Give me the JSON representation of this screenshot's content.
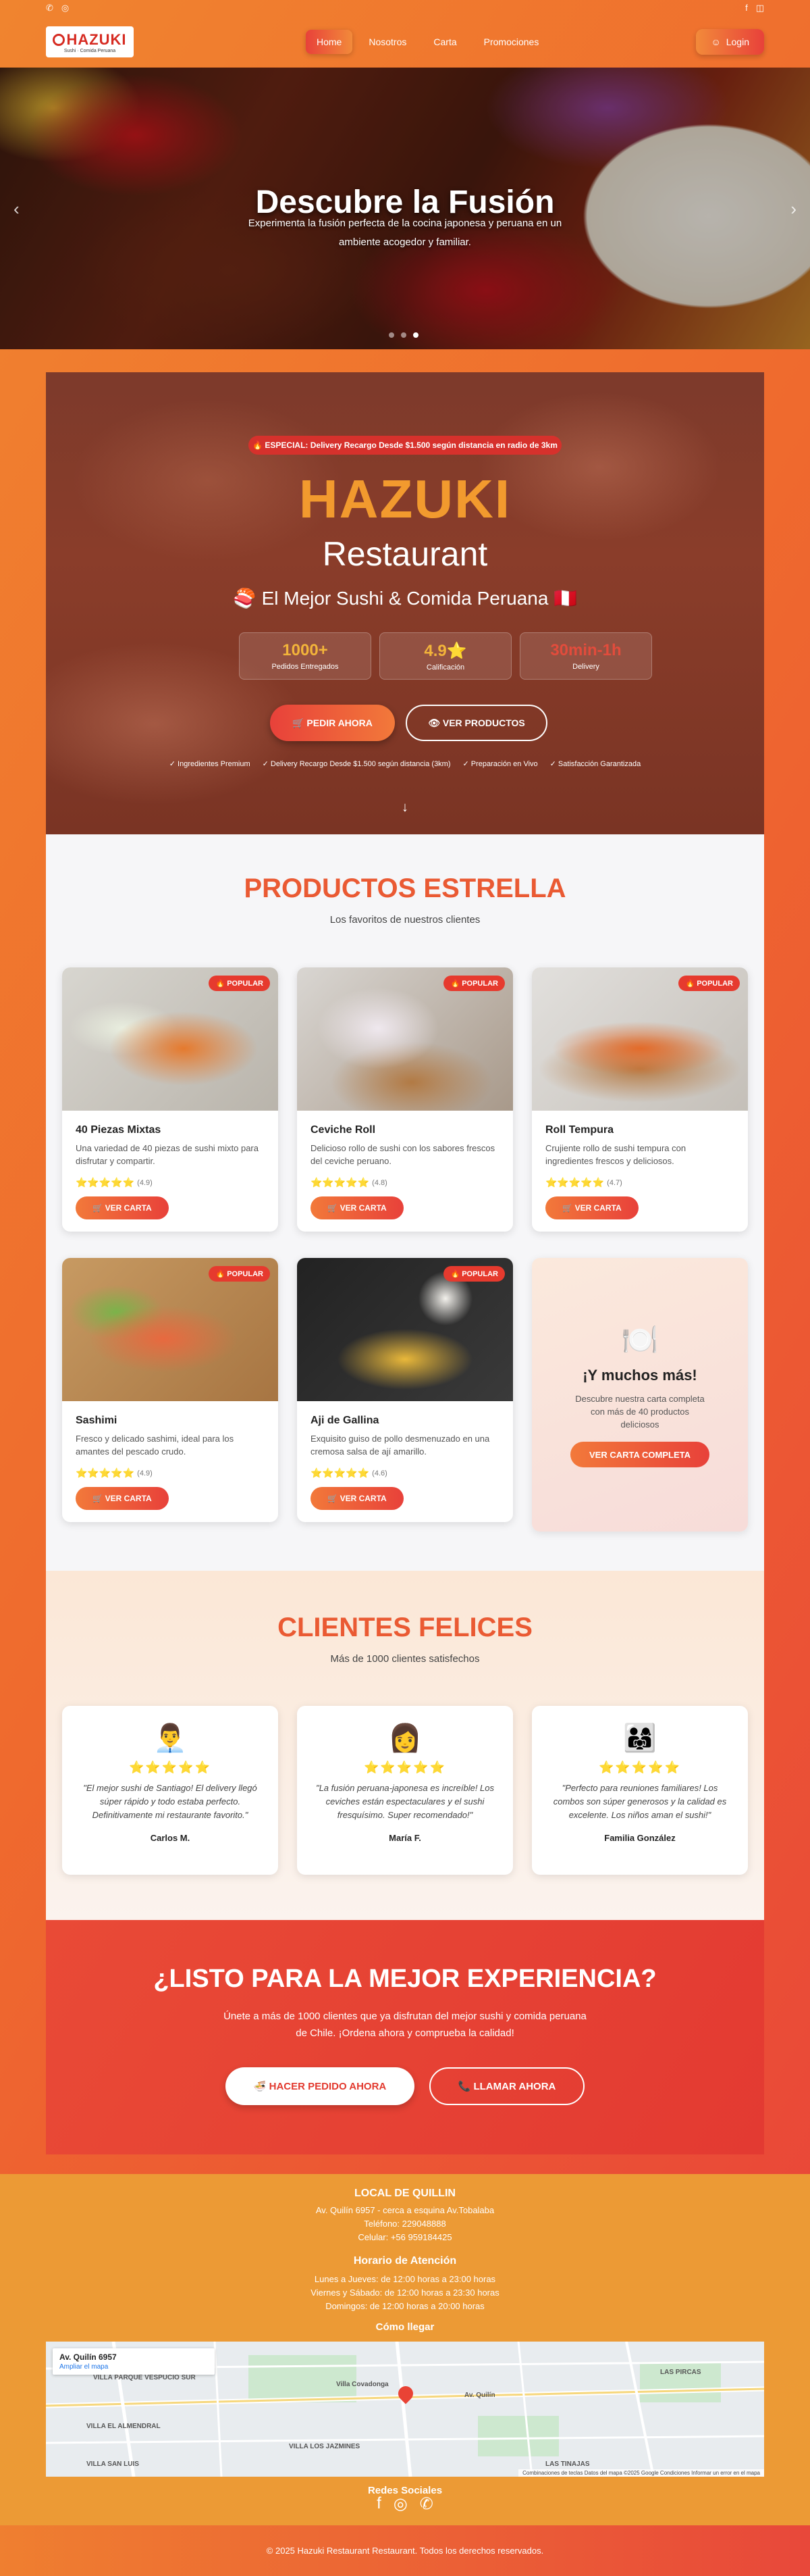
{
  "topbar": {
    "phone_icon": "phone-icon",
    "whatsapp_icon": "whatsapp-icon",
    "facebook_icon": "facebook-icon",
    "instagram_icon": "instagram-icon"
  },
  "logo": {
    "name": "HAZUKI",
    "tagline": "Sushi · Comida Peruana"
  },
  "nav": {
    "items": [
      {
        "label": "Home",
        "active": true
      },
      {
        "label": "Nosotros"
      },
      {
        "label": "Carta"
      },
      {
        "label": "Promociones"
      }
    ],
    "login": "Login"
  },
  "hero": {
    "title": "Descubre la Fusión",
    "subtitle": "Experimenta la fusión perfecta de la cocina japonesa y peruana en un ambiente acogedor y familiar."
  },
  "brand": {
    "special": "🔥 ESPECIAL: Delivery Recargo Desde $1.500 según distancia en radio de 3km",
    "name": "HAZUKI",
    "restaurant": "Restaurant",
    "tagline": "🍣 El Mejor Sushi & Comida Peruana 🇵🇪",
    "stats": [
      {
        "value": "1000+",
        "label": "Pedidos Entregados"
      },
      {
        "value": "4.9⭐",
        "label": "Calificación"
      },
      {
        "value": "30min-1h",
        "label": "Delivery"
      }
    ],
    "order_button": "🛒 PEDIR AHORA",
    "products_button": "👁 VER PRODUCTOS",
    "features": [
      "✓ Ingredientes Premium",
      "✓ Delivery Recargo Desde $1.500 según distancia (3km)",
      "✓ Preparación en Vivo",
      "✓ Satisfacción Garantizada"
    ]
  },
  "products": {
    "title": "PRODUCTOS ESTRELLA",
    "subtitle": "Los favoritos de nuestros clientes",
    "badge": "🔥 POPULAR",
    "button": "🛒 VER CARTA",
    "items": [
      {
        "name": "40 Piezas Mixtas",
        "desc": "Una variedad de 40 piezas de sushi mixto para disfrutar y compartir.",
        "stars": "⭐⭐⭐⭐⭐",
        "rating": "(4.9)"
      },
      {
        "name": "Ceviche Roll",
        "desc": "Delicioso rollo de sushi con los sabores frescos del ceviche peruano.",
        "stars": "⭐⭐⭐⭐⭐",
        "rating": "(4.8)"
      },
      {
        "name": "Roll Tempura",
        "desc": "Crujiente rollo de sushi tempura con ingredientes frescos y deliciosos.",
        "stars": "⭐⭐⭐⭐⭐",
        "rating": "(4.7)"
      },
      {
        "name": "Sashimi",
        "desc": "Fresco y delicado sashimi, ideal para los amantes del pescado crudo.",
        "stars": "⭐⭐⭐⭐⭐",
        "rating": "(4.9)"
      },
      {
        "name": "Aji de Gallina",
        "desc": "Exquisito guiso de pollo desmenuzado en una cremosa salsa de ají amarillo.",
        "stars": "⭐⭐⭐⭐⭐",
        "rating": "(4.6)"
      }
    ],
    "more": {
      "icon": "🍽️",
      "title": "¡Y muchos más!",
      "desc": "Descubre nuestra carta completa con más de 40 productos deliciosos",
      "button": "VER CARTA COMPLETA"
    }
  },
  "testimonials": {
    "title": "CLIENTES FELICES",
    "subtitle": "Más de 1000 clientes satisfechos",
    "stars": "⭐⭐⭐⭐⭐",
    "items": [
      {
        "avatar": "👨‍💼",
        "quote": "\"El mejor sushi de Santiago! El delivery llegó súper rápido y todo estaba perfecto. Definitivamente mi restaurante favorito.\"",
        "name": "Carlos M."
      },
      {
        "avatar": "👩",
        "quote": "\"La fusión peruana-japonesa es increíble! Los ceviches están espectaculares y el sushi fresquísimo. Super recomendado!\"",
        "name": "María F."
      },
      {
        "avatar": "👨‍👩‍👧",
        "quote": "\"Perfecto para reuniones familiares! Los combos son súper generosos y la calidad es excelente. Los niños aman el sushi!\"",
        "name": "Familia González"
      }
    ]
  },
  "cta": {
    "title": "¿LISTO PARA LA MEJOR EXPERIENCIA?",
    "desc": "Únete a más de 1000 clientes que ya disfrutan del mejor sushi y comida peruana de Chile. ¡Ordena ahora y comprueba la calidad!",
    "order": "🍜 HACER PEDIDO AHORA",
    "call": "📞 LLAMAR AHORA"
  },
  "footer": {
    "local_title": "LOCAL DE QUILLIN",
    "address": "Av. Quilín 6957 - cerca a esquina Av.Tobalaba",
    "phone": "Teléfono: 229048888",
    "cell": "Celular: +56 959184425",
    "hours_title": "Horario de Atención",
    "hours": [
      "Lunes a Jueves: de 12:00 horas a 23:00 horas",
      "Viernes y Sábado: de 12:00 horas a 23:30 horas",
      "Domingos: de 12:00 horas a 20:00 horas"
    ],
    "map_title": "Cómo llegar",
    "map_place": "Av. Quilín 6957",
    "map_link": "Ampliar el mapa",
    "map_labels": [
      "VILLA PARQUE VESPUCIO SUR",
      "VILLA EL ALMENDRAL",
      "VILLA LOS JAZMINES",
      "LAS PIRCAS",
      "LAS TINAJAS",
      "VILLA SAN LUIS",
      "Av. Quilín",
      "Villa Covadonga"
    ],
    "map_attribution": "Combinaciones de teclas   Datos del mapa ©2025 Google   Condiciones   Informar un error en el mapa",
    "social_title": "Redes Sociales",
    "copyright": "© 2025 Hazuki Restaurant Restaurant. Todos los derechos reservados."
  }
}
